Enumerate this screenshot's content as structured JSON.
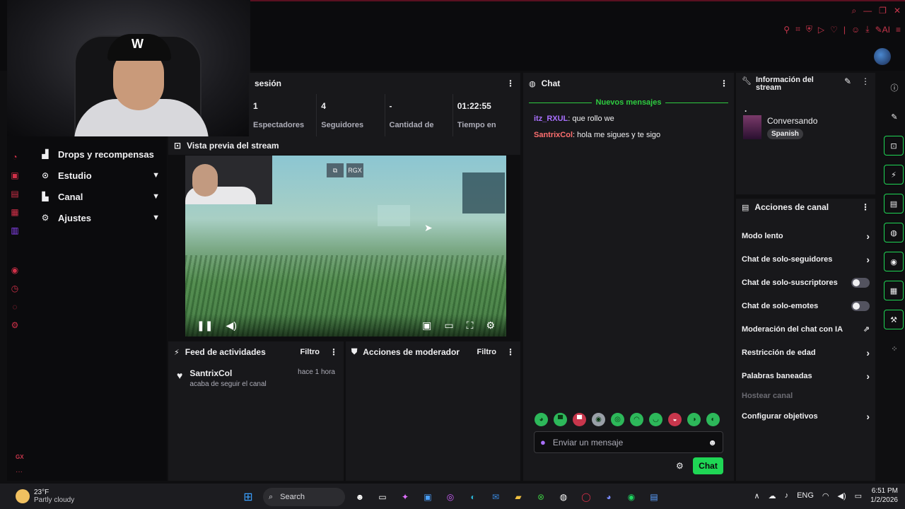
{
  "colors": {
    "accent": "#1fd655",
    "brand_red": "#c8364c",
    "panel_bg": "#18181b",
    "page_bg": "#0f0f11"
  },
  "left_nav": {
    "items": [
      {
        "label": "Drops y recompensas",
        "icon": "gift-icon",
        "expandable": false
      },
      {
        "label": "Estudio",
        "icon": "studio-icon",
        "expandable": true
      },
      {
        "label": "Canal",
        "icon": "channel-icon",
        "expandable": true
      },
      {
        "label": "Ajustes",
        "icon": "settings-icon",
        "expandable": true
      }
    ],
    "bottom_badge": "GX"
  },
  "session": {
    "title": "sesión",
    "stats": [
      {
        "value": "1",
        "label": "Espectadores"
      },
      {
        "value": "4",
        "label": "Seguidores"
      },
      {
        "value": "-",
        "label": "Cantidad de"
      },
      {
        "value": "01:22:55",
        "label": "Tiempo en"
      }
    ]
  },
  "preview": {
    "title": "Vista previa del stream",
    "overlay_button": "RGX"
  },
  "feed": {
    "title": "Feed de actividades",
    "filter_label": "Filtro",
    "items": [
      {
        "name": "SantrixCol",
        "desc": "acaba de seguir el canal",
        "time": "hace 1 hora"
      }
    ]
  },
  "mod_actions": {
    "title": "Acciones de moderador",
    "filter_label": "Filtro"
  },
  "chat": {
    "title": "Chat",
    "new_messages": "Nuevos mensajes",
    "messages": [
      {
        "user": "itz_RXUL",
        "text": "que rollo we"
      },
      {
        "user": "SantrixCol",
        "text": "hola me sigues y te sigo"
      }
    ],
    "input_placeholder": "Enviar un mensaje",
    "send_label": "Chat"
  },
  "stream_info": {
    "title_line1": "Información del",
    "title_line2": "stream",
    "stream_title": ".",
    "category": "Conversando",
    "tag": "Spanish"
  },
  "channel_actions": {
    "title": "Acciones de canal",
    "items": [
      {
        "label": "Modo lento",
        "control": "arrow"
      },
      {
        "label": "Chat de solo-seguidores",
        "control": "arrow"
      },
      {
        "label": "Chat de solo-suscriptores",
        "control": "toggle",
        "on": false
      },
      {
        "label": "Chat de solo-emotes",
        "control": "toggle",
        "on": false
      },
      {
        "label": "Moderación del chat con IA",
        "control": "external"
      },
      {
        "label": "Restricción de edad",
        "control": "arrow"
      },
      {
        "label": "Palabras baneadas",
        "control": "arrow"
      },
      {
        "label": "Hostear canal",
        "control": "none",
        "disabled": true
      },
      {
        "label": "Configurar objetivos",
        "control": "arrow"
      }
    ]
  },
  "taskbar": {
    "weather_temp": "23°F",
    "weather_desc": "Partly cloudy",
    "search_label": "Search",
    "language": "ENG",
    "time": "6:51 PM",
    "date": "1/2/2026"
  }
}
